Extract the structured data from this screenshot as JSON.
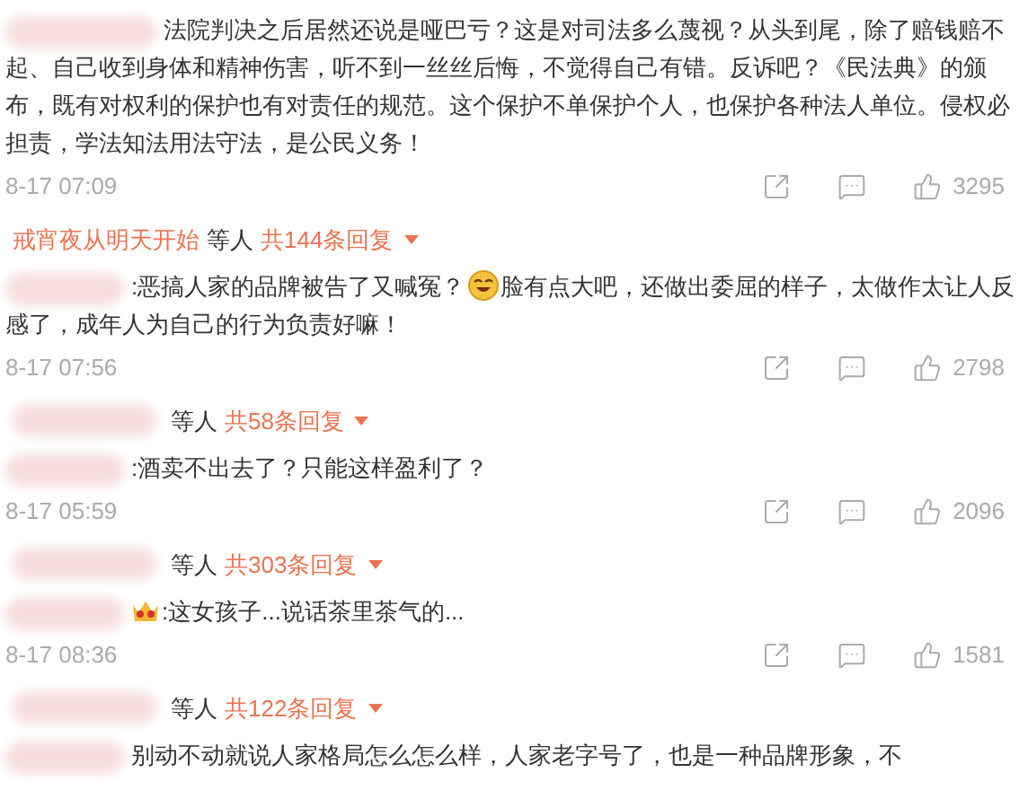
{
  "comments": [
    {
      "segments": [
        {
          "kind": "text",
          "text": "法院判决之后居然还说是哑巴亏？这是对司法多么蔑视？从头到尾，除了赔钱赔不起、自己收到身体和精神伤害，听不到一丝丝后悔，不觉得自己有错。反诉吧？《民法典》的颁布，既有对权利的保护也有对责任的规范。这个保护不单保护个人，也保护各种法人单位。侵权必担责，学法知法用法守法，是公民义务！"
        }
      ],
      "time": "8-17 07:09",
      "likes": "3295",
      "reply": {
        "user": "戒宵夜从明天开始",
        "suffix": "等人",
        "count": "共144条回复"
      }
    },
    {
      "segments": [
        {
          "kind": "text",
          "text": ":恶搞人家的品牌被告了又喊冤？"
        },
        {
          "kind": "emoji"
        },
        {
          "kind": "text",
          "text": "脸有点大吧，还做出委屈的样子，太做作太让人反感了，成年人为自己的行为负责好嘛！"
        }
      ],
      "time": "8-17 07:56",
      "likes": "2798",
      "reply": {
        "suffix": "等人",
        "count": "共58条回复"
      }
    },
    {
      "segments": [
        {
          "kind": "text",
          "text": ":酒卖不出去了？只能这样盈利了？"
        }
      ],
      "time": "8-17 05:59",
      "likes": "2096",
      "reply": {
        "suffix": "等人",
        "count": "共303条回复"
      }
    },
    {
      "segments": [
        {
          "kind": "crown"
        },
        {
          "kind": "text",
          "text": ":这女孩子...说话茶里茶气的..."
        }
      ],
      "time": "8-17 08:36",
      "likes": "1581",
      "reply": {
        "suffix": "等人",
        "count": "共122条回复"
      }
    },
    {
      "segments": [
        {
          "kind": "text",
          "text": "别动不动就说人家格局怎么怎么样，人家老字号了，也是一种品牌形象，不"
        }
      ]
    }
  ]
}
